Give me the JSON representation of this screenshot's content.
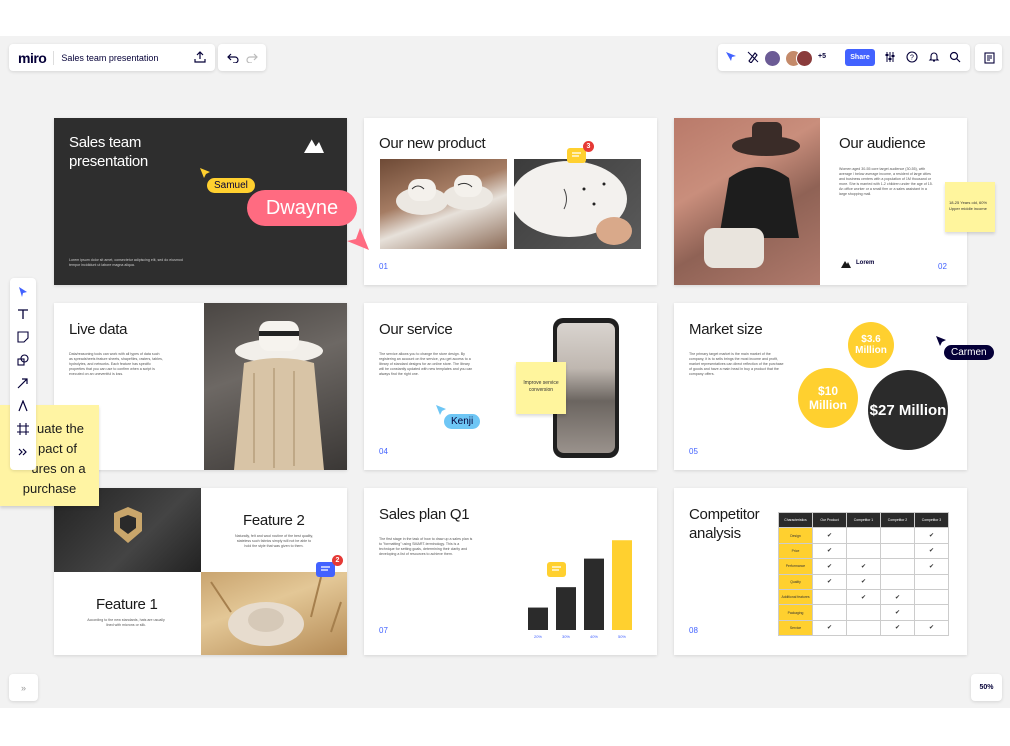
{
  "topbar": {
    "logo": "miro",
    "board_name": "Sales team presentation",
    "extra_collaborators": "+5",
    "share_label": "Share"
  },
  "zoom": "50%",
  "slides": {
    "s1": {
      "title_line1": "Sales team",
      "title_line2": "presentation",
      "body": "Lorem ipsum dolor sit amet, consectetur adipiscing elit, sed do eiusmod tempor incididunt ut labore magna aliqua."
    },
    "s2": {
      "title": "Our new product",
      "number": "01",
      "comment_count": "3"
    },
    "s3": {
      "title": "Our audience",
      "body": "Women aged 30-55 core target audience (30-55), with average / below average income, a resident of large cities and business centers with a population of 1M thousand or more. She is married with 1-2 children under the age of 15. An office worker or a small firm or a sales assistant in a large shopping mall.",
      "sticky": "18-25 Years old, 60% Upper middle income",
      "logo": "Lorem",
      "number": "02"
    },
    "s4": {
      "title": "Live data",
      "body": "Data/reasoning tools can work with all types of data such as spreadsheets feature sheets, shapefiles, rasters, tables, hydrolytes, and networks. Each feature has specific properties that you can use to confirm when a script is executed on an uneventful is loss."
    },
    "s5": {
      "title": "Our service",
      "body": "The service allows you to change the store design. By registering an account on the service, you get access to a library of standard designs for an online store. The library will be constantly updated with new templates and you can always find the right one.",
      "sticky": "Improve service conversion",
      "number": "04"
    },
    "s6": {
      "title": "Market size",
      "body": "The primary target market is the main market of the company, it is to sells brings the most income and profit, market representatives can direct reflection of the purchase of goods and have a main head in buy a product that the company offers.",
      "circle_small": "$3.6 Million",
      "circle_mid": "$10 Million",
      "circle_big": "$27 Million",
      "number": "05"
    },
    "s7": {
      "feature2_title": "Feature 2",
      "feature2_body": "Naturally, felt and wool routine of the best quality, stateless such fabrics simply will not be able to hold the style that was given to them.",
      "feature1_title": "Feature 1",
      "feature1_body": "According to the new standards, hats are usually lined with microns or silk.",
      "comment_count": "2"
    },
    "s8": {
      "title": "Sales plan Q1",
      "body": "The first stage in the task of how to draw up a sales plan is to \"formatting\" using SMART-terminology. This is a technique for setting goals, determining their clarity and developing a list of resources to achieve them.",
      "number": "07"
    },
    "s9": {
      "title_line1": "Competitor",
      "title_line2": "analysis",
      "number": "08",
      "table": {
        "headers": [
          "Characteristics",
          "Our Product",
          "Competitor 1",
          "Competitor 2",
          "Competitor 3"
        ],
        "rows": [
          {
            "label": "Design",
            "marks": [
              "✔",
              "",
              "",
              "✔"
            ]
          },
          {
            "label": "Price",
            "marks": [
              "✔",
              "",
              "",
              "✔"
            ]
          },
          {
            "label": "Performance",
            "marks": [
              "✔",
              "✔",
              "",
              "✔"
            ]
          },
          {
            "label": "Quality",
            "marks": [
              "✔",
              "✔",
              "",
              ""
            ]
          },
          {
            "label": "Additional features",
            "marks": [
              "",
              "✔",
              "✔",
              ""
            ]
          },
          {
            "label": "Packaging",
            "marks": [
              "",
              "",
              "✔",
              ""
            ]
          },
          {
            "label": "Service",
            "marks": [
              "✔",
              "",
              "✔",
              "✔"
            ]
          }
        ]
      }
    }
  },
  "chart_data": {
    "type": "bar",
    "categories": [
      "",
      "",
      "",
      ""
    ],
    "values": [
      22,
      42,
      70,
      88
    ],
    "ylim": [
      0,
      100
    ],
    "colors": [
      "#2b2b2b",
      "#2b2b2b",
      "#2b2b2b",
      "#ffd02f"
    ],
    "tick_labels": [
      "20%",
      "30%",
      "40%",
      "50%"
    ]
  },
  "cursors": {
    "samuel": "Samuel",
    "dwayne": "Dwayne",
    "kenji": "Kenji",
    "carmen": "Carmen"
  },
  "left_sticky": {
    "line1": "uate the",
    "line2": "pact of",
    "line3": "ures on a",
    "line4": "purchase"
  },
  "colors": {
    "accent": "#4262ff",
    "yellow": "#ffd02f",
    "dark": "#2b2b2b",
    "dwayne": "#ff6b81",
    "kenji": "#6ec6f5"
  }
}
